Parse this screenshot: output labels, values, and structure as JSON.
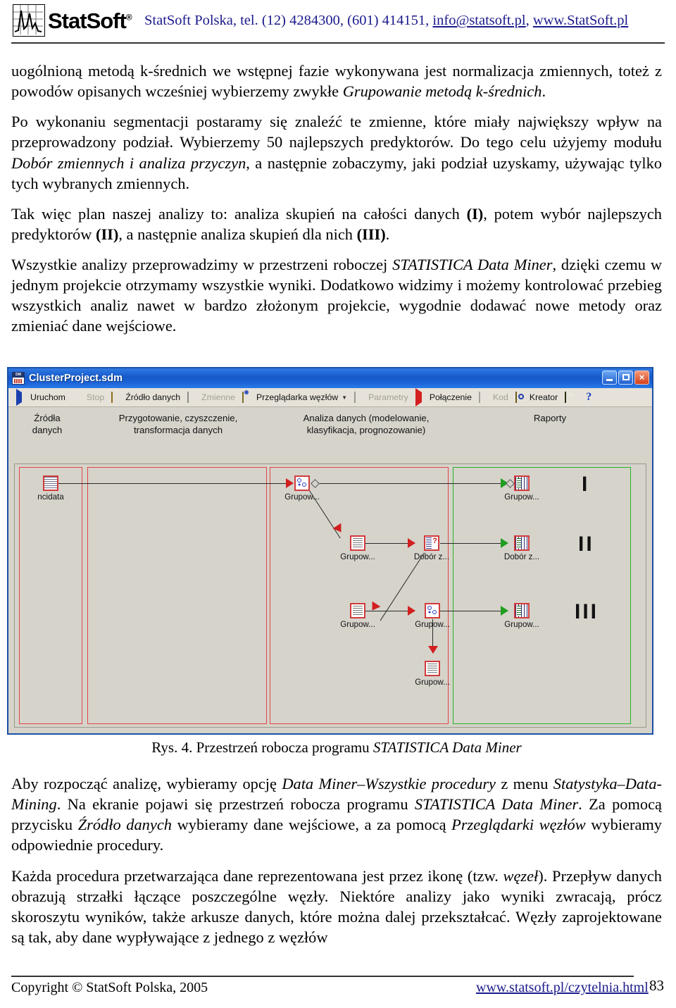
{
  "header": {
    "logo_word": "StatSoft",
    "logo_reg": "®",
    "contact_prefix": "StatSoft Polska, tel. (12) 4284300, (601) 414151, ",
    "email": "info@statsoft.pl",
    "comma": ", ",
    "website": "www.StatSoft.pl"
  },
  "body_top": {
    "p1_a": "uogólnioną metodą k-średnich we wstępnej fazie wykonywana jest normalizacja zmiennych, toteż z powodów opisanych wcześniej wybierzemy zwykłe ",
    "p1_i": "Grupowanie metodą k-średnich",
    "p1_b": ".",
    "p2_a": "Po wykonaniu segmentacji postaramy się znaleźć te zmienne, które miały największy wpływ na przeprowadzony podział. Wybierzemy 50 najlepszych predyktorów. Do tego celu użyjemy modułu ",
    "p2_i": "Dobór zmiennych i analiza przyczyn",
    "p2_b": ", a następnie zobaczymy, jaki podział uzyskamy, używając tylko tych wybranych zmiennych.",
    "p3_a": "Tak więc plan naszej analizy to: analiza skupień na całości danych ",
    "p3_b1": "(I)",
    "p3_b": ", potem wybór najlepszych predyktorów ",
    "p3_b2": "(II)",
    "p3_c": ", a następnie analiza skupień dla nich ",
    "p3_b3": "(III)",
    "p3_d": ".",
    "p4_a": "Wszystkie analizy przeprowadzimy w przestrzeni roboczej ",
    "p4_i": "STATISTICA Data Miner",
    "p4_b": ", dzięki czemu w jednym projekcie otrzymamy wszystkie wyniki. Dodatkowo widzimy i możemy kontrolować przebieg wszystkich analiz nawet w bardzo złożonym projekcie, wygodnie dodawać nowe metody oraz zmieniać dane wejściowe."
  },
  "screenshot": {
    "title": "ClusterProject.sdm",
    "window_buttons": {
      "minimize": "minimize",
      "maximize": "maximize",
      "close": "×"
    },
    "toolbar": [
      {
        "label": "Uruchom",
        "icon": "run-icon",
        "disabled": false
      },
      {
        "label": "Stop",
        "icon": "stop-icon",
        "disabled": true
      },
      {
        "label": "Źródło danych",
        "icon": "folder-icon",
        "disabled": false
      },
      {
        "label": "Zmienne",
        "icon": "variables-icon",
        "disabled": true
      },
      {
        "label": "Przeglądarka węzłów",
        "icon": "node-browser-icon",
        "disabled": false,
        "caret": "▼"
      },
      {
        "label": "Parametry",
        "icon": "parameters-icon",
        "disabled": true
      },
      {
        "label": "Połączenie",
        "icon": "connection-icon",
        "disabled": false
      },
      {
        "label": "Kod",
        "icon": "code-icon",
        "disabled": true
      },
      {
        "label": "Kreator",
        "icon": "wizard-icon",
        "disabled": false
      },
      {
        "label": "",
        "icon": "save-icon",
        "disabled": false
      },
      {
        "label": "?",
        "icon": "help-icon",
        "disabled": false
      }
    ],
    "columns": [
      {
        "line1": "Źródła",
        "line2": "danych"
      },
      {
        "line1": "Przygotowanie, czyszczenie,",
        "line2": "transformacja danych"
      },
      {
        "line1": "Analiza danych (modelowanie,",
        "line2": "klasyfikacja, prognozowanie)"
      },
      {
        "line1": "Raporty",
        "line2": ""
      }
    ],
    "nodes": [
      {
        "id": "src",
        "label": "ncidata",
        "kind": "sheet"
      },
      {
        "id": "clust1",
        "label": "Grupow...",
        "kind": "cluster"
      },
      {
        "id": "grid1",
        "label": "Grupow...",
        "kind": "plain"
      },
      {
        "id": "dobor1",
        "label": "Dobór z...",
        "kind": "dobor"
      },
      {
        "id": "grid2",
        "label": "Grupow...",
        "kind": "plain"
      },
      {
        "id": "clust2",
        "label": "Grupow...",
        "kind": "cluster"
      },
      {
        "id": "grid3",
        "label": "Grupow...",
        "kind": "plain"
      },
      {
        "id": "rep1",
        "label": "Grupow...",
        "kind": "report"
      },
      {
        "id": "rep2",
        "label": "Dobór z...",
        "kind": "report"
      },
      {
        "id": "rep3",
        "label": "Grupow...",
        "kind": "report"
      }
    ],
    "markers": [
      "I",
      "II",
      "III"
    ],
    "colors": {
      "lane_red": "#e04646",
      "lane_green": "#27b327",
      "node_border": "#d23b3b",
      "arrow_red": "#d21f1f",
      "arrow_green": "#1f9e1f",
      "titlebar_blue": "#1559c8",
      "canvas_bg": "#d6d3cb"
    }
  },
  "caption": {
    "prefix": "Rys. 4. Przestrzeń robocza programu ",
    "italic": "STATISTICA Data Miner"
  },
  "body_bottom": {
    "p5_a": "Aby rozpocząć analizę, wybieramy opcję ",
    "p5_i1": "Data Miner–Wszystkie procedury",
    "p5_b": " z menu ",
    "p5_i2": "Statystyka–Data-Mining",
    "p5_c": ". Na ekranie pojawi się przestrzeń robocza programu ",
    "p5_i3": "STATISTICA Data Miner",
    "p5_d": ". Za pomocą przycisku ",
    "p5_i4": "Źródło danych",
    "p5_e": " wybieramy dane wejściowe, a za pomocą ",
    "p5_i5": "Przeglądarki węzłów",
    "p5_f": " wybieramy odpowiednie procedury.",
    "p6_a": "Każda procedura przetwarzająca dane reprezentowana jest przez ikonę (tzw. ",
    "p6_i": "węzeł",
    "p6_b": "). Przepływ danych obrazują strzałki łączące poszczególne węzły. Niektóre analizy jako wyniki zwracają, prócz skoroszytu wyników, także arkusze danych, które można dalej przekształcać. Węzły zaprojektowane są tak, aby dane wypływające z jednego z węzłów"
  },
  "footer": {
    "copyright": "Copyright © StatSoft Polska, 2005",
    "url": "www.statsoft.pl/czytelnia.html",
    "page": "83"
  }
}
